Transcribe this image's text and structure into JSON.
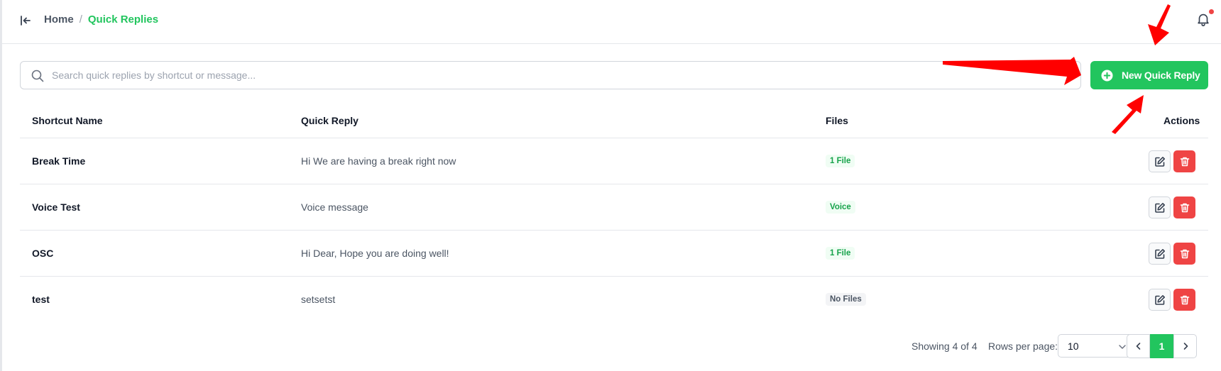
{
  "breadcrumb": {
    "home": "Home",
    "separator": "/",
    "current": "Quick Replies"
  },
  "icons": {
    "collapse": "collapse-sidebar-icon",
    "bell": "bell-icon",
    "search": "search-icon",
    "add": "plus-circle-icon",
    "edit": "edit-icon",
    "delete": "trash-icon"
  },
  "search": {
    "placeholder": "Search quick replies by shortcut or message...",
    "value": ""
  },
  "new_button": {
    "label": "New Quick Reply"
  },
  "table": {
    "headers": {
      "shortcut": "Shortcut Name",
      "reply": "Quick Reply",
      "files": "Files",
      "actions": "Actions"
    },
    "rows": [
      {
        "shortcut": "Break Time",
        "reply": "Hi We are having a break right now",
        "files": "1 File"
      },
      {
        "shortcut": "Voice Test",
        "reply": "Voice message",
        "files": "Voice"
      },
      {
        "shortcut": "OSC",
        "reply": "Hi Dear, Hope you are doing well!",
        "files": "1 File"
      },
      {
        "shortcut": "test",
        "reply": "setsetst",
        "files": "No Files"
      }
    ]
  },
  "pagination": {
    "showing": "Showing 4 of 4",
    "rows_per_page_label": "Rows per page:",
    "rows_per_page": "10",
    "current_page": "1"
  },
  "colors": {
    "accent": "#22c55e",
    "danger": "#ef4444",
    "annotation_arrow": "#ff0000"
  }
}
